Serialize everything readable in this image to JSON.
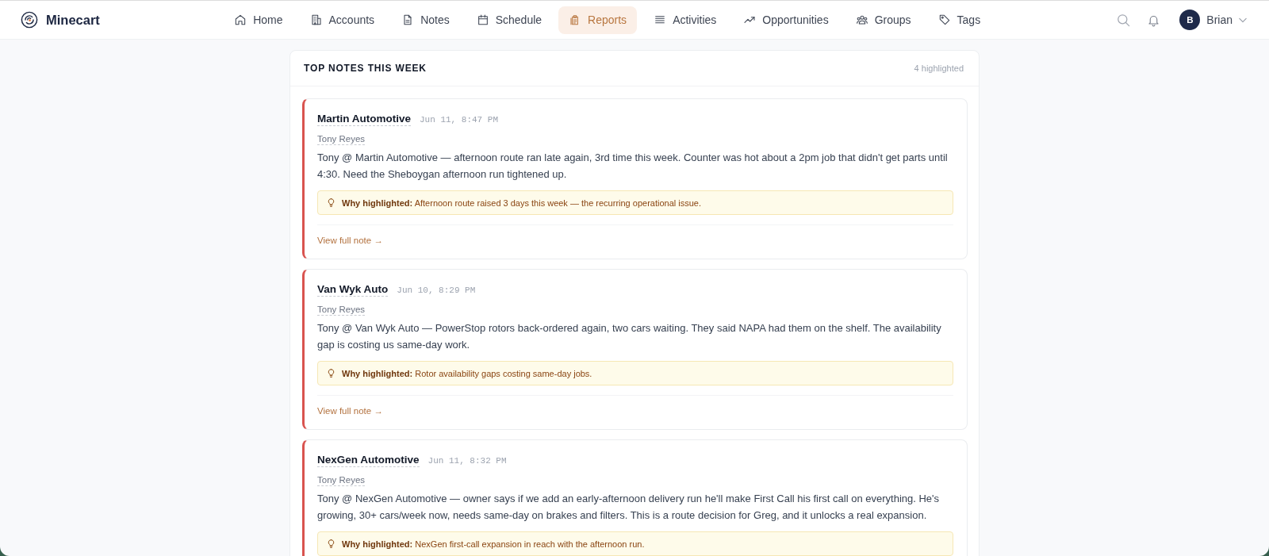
{
  "app": {
    "name": "Minecart"
  },
  "nav": [
    {
      "label": "Home",
      "selected": false
    },
    {
      "label": "Accounts",
      "selected": false
    },
    {
      "label": "Notes",
      "selected": false
    },
    {
      "label": "Schedule",
      "selected": false
    },
    {
      "label": "Reports",
      "selected": true
    },
    {
      "label": "Activities",
      "selected": false
    },
    {
      "label": "Opportunities",
      "selected": false
    },
    {
      "label": "Groups",
      "selected": false
    },
    {
      "label": "Tags",
      "selected": false
    }
  ],
  "user": {
    "initial": "B",
    "name": "Brian"
  },
  "panel": {
    "title": "TOP NOTES THIS WEEK",
    "count": "4 highlighted",
    "notes": [
      {
        "account": "Martin Automotive",
        "time": "Jun 11, 8:47 PM",
        "author": "Tony Reyes",
        "body": "Tony @ Martin Automotive — afternoon route ran late again, 3rd time this week. Counter was hot about a 2pm job that didn't get parts until 4:30. Need the Sheboygan afternoon run tightened up.",
        "highlight": "**Why highlighted:** Afternoon route raised 3 days this week — the recurring operational issue.",
        "link": "View full note →"
      },
      {
        "account": "Van Wyk Auto",
        "time": "Jun 10, 8:29 PM",
        "author": "Tony Reyes",
        "body": "Tony @ Van Wyk Auto — PowerStop rotors back-ordered again, two cars waiting. They said NAPA had them on the shelf. The availability gap is costing us same-day work.",
        "highlight": "**Why highlighted:** Rotor availability gaps costing same-day jobs.",
        "link": "View full note →"
      },
      {
        "account": "NexGen Automotive",
        "time": "Jun 11, 8:32 PM",
        "author": "Tony Reyes",
        "body": "Tony @ NexGen Automotive — owner says if we add an early-afternoon delivery run he'll make First Call his first call on everything. He's growing, 30+ cars/week now, needs same-day on brakes and filters. This is a route decision for Greg, and it unlocks a real expansion.",
        "highlight": "**Why highlighted:** NexGen first-call expansion in reach with the afternoon run."
      }
    ]
  }
}
